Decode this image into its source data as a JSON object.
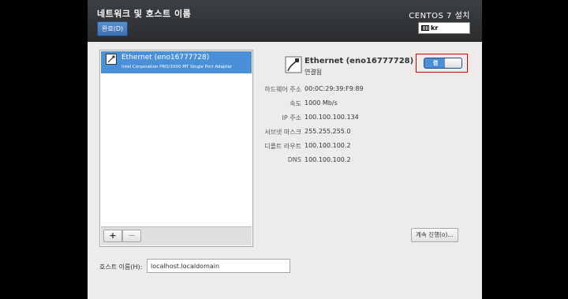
{
  "header": {
    "spoke_title": "네트워크 및 호스트 이름",
    "done_label": "완료(D)",
    "product_title": "CENTOS 7 설치",
    "keyboard_layout": "kr"
  },
  "devices": [
    {
      "name": "Ethernet (eno16777728)",
      "description": "Intel Corporation PRO/1000 MT Single Port Adapter"
    }
  ],
  "list_toolbar": {
    "add_label": "+",
    "remove_label": "−"
  },
  "detail": {
    "name": "Ethernet (eno16777728)",
    "status": "연결됨",
    "toggle_label": "켬",
    "toggle_on": true,
    "properties": [
      {
        "label": "하드웨어 주소",
        "value": "00:0C:29:39:F9:89"
      },
      {
        "label": "속도",
        "value": "1000 Mb/s"
      },
      {
        "label": "IP 주소",
        "value": "100.100.100.134"
      },
      {
        "label": "서브넷 마스크",
        "value": "255.255.255.0"
      },
      {
        "label": "디폴트 라우트",
        "value": "100.100.100.2"
      },
      {
        "label": "DNS",
        "value": "100.100.100.2"
      }
    ],
    "configure_label": "계속 진행(o)..."
  },
  "hostname": {
    "label": "호스트 이름(H):",
    "value": "localhost.localdomain"
  },
  "colors": {
    "selection": "#4a90d9",
    "header_bg": "#333537",
    "window_bg": "#edeceb",
    "highlight_box": "#cc0000"
  }
}
